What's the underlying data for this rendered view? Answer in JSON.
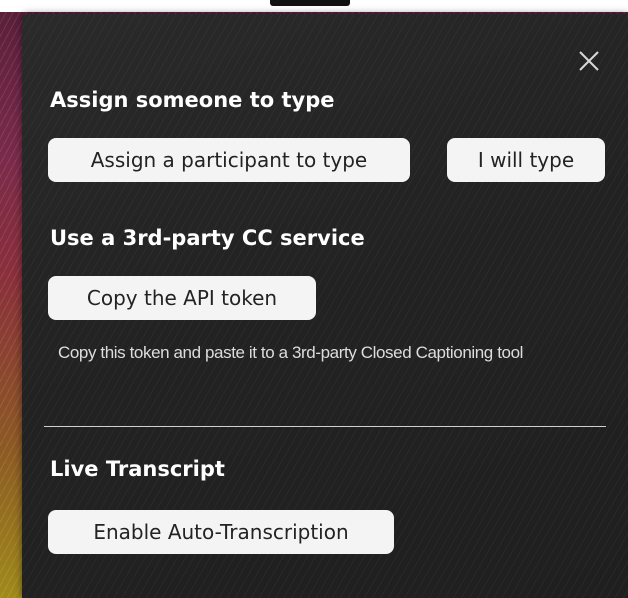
{
  "assign": {
    "heading": "Assign someone to type",
    "assign_participant_label": "Assign a participant to type",
    "i_will_type_label": "I will type"
  },
  "third_party": {
    "heading": "Use a 3rd-party CC service",
    "copy_token_label": "Copy the API token",
    "description": "Copy this token and paste it to a 3rd-party Closed Captioning tool"
  },
  "live_transcript": {
    "heading": "Live Transcript",
    "enable_auto_label": "Enable Auto-Transcription"
  },
  "icons": {
    "close": "close-icon"
  },
  "colors": {
    "panel": "#242424",
    "button": "#f4f4f4",
    "text": "#ffffff"
  }
}
